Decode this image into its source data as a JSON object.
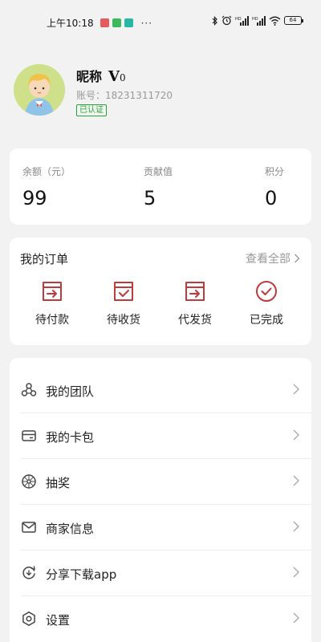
{
  "status_bar": {
    "time": "上午10:18",
    "dots": "···",
    "battery": "64",
    "app_icons": [
      "app-icon-red",
      "app-icon-green",
      "app-icon-teal"
    ],
    "app_icon_colors": [
      "#e35b5b",
      "#3cb95a",
      "#27b7a4"
    ],
    "right_icons": [
      "bluetooth-icon",
      "alarm-icon",
      "signal-icon",
      "signal-icon",
      "wifi-icon",
      "battery-icon"
    ]
  },
  "profile": {
    "nickname": "昵称",
    "vip_letter": "V",
    "vip_level": "0",
    "account_label": "账号：",
    "account_number": "18231311720",
    "verified_badge": "已认证"
  },
  "stats": [
    {
      "label": "余额（元）",
      "value": "99"
    },
    {
      "label": "贡献值",
      "value": "5"
    },
    {
      "label": "积分",
      "value": "0"
    }
  ],
  "orders": {
    "title": "我的订单",
    "view_all": "查看全部",
    "items": [
      {
        "label": "待付款",
        "icon": "pending-payment-icon"
      },
      {
        "label": "待收货",
        "icon": "pending-receipt-icon"
      },
      {
        "label": "代发货",
        "icon": "pending-shipment-icon"
      },
      {
        "label": "已完成",
        "icon": "completed-icon"
      }
    ]
  },
  "menu": [
    {
      "label": "我的团队",
      "icon": "team-icon"
    },
    {
      "label": "我的卡包",
      "icon": "card-wallet-icon"
    },
    {
      "label": "抽奖",
      "icon": "lottery-icon"
    },
    {
      "label": "商家信息",
      "icon": "merchant-info-icon"
    },
    {
      "label": "分享下载app",
      "icon": "share-download-icon"
    },
    {
      "label": "设置",
      "icon": "settings-icon"
    }
  ],
  "colors": {
    "accent": "#c0393b",
    "verified": "#2e9d3c",
    "background": "#f2f2f2"
  }
}
